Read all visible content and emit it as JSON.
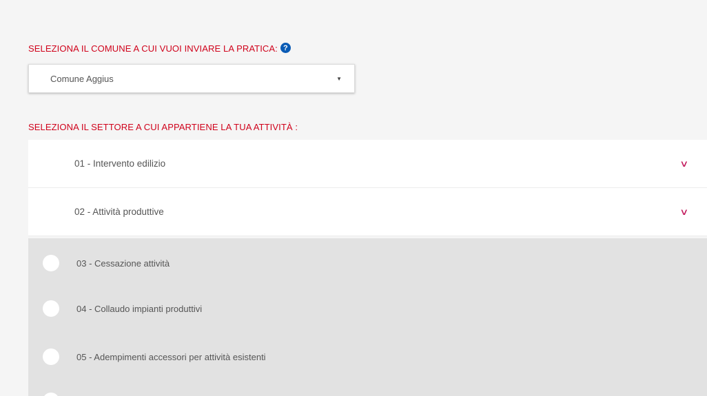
{
  "comune_label": "SELEZIONA IL COMUNE A CUI VUOI INVIARE LA PRATICA:",
  "help_icon_glyph": "?",
  "comune_select": {
    "value": "Comune Aggius"
  },
  "settore_label": "SELEZIONA IL SETTORE A CUI APPARTIENE LA TUA ATTIVITÀ :",
  "accordion": [
    {
      "label": "01 - Intervento edilizio"
    },
    {
      "label": "02 - Attività produttive"
    }
  ],
  "options": [
    {
      "label": "03 - Cessazione attività"
    },
    {
      "label": "04 - Collaudo impianti produttivi"
    },
    {
      "label": "05 - Adempimenti accessori per attività esistenti"
    }
  ],
  "colors": {
    "label_red": "#d0021b",
    "help_blue": "#0a5bb5",
    "chevron": "#c2185b",
    "option_bg": "#e2e2e2"
  },
  "icons": {
    "help": "question-circle-icon",
    "caret": "caret-down-icon",
    "chevron": "chevron-down-icon",
    "radio": "radio-button-icon"
  }
}
